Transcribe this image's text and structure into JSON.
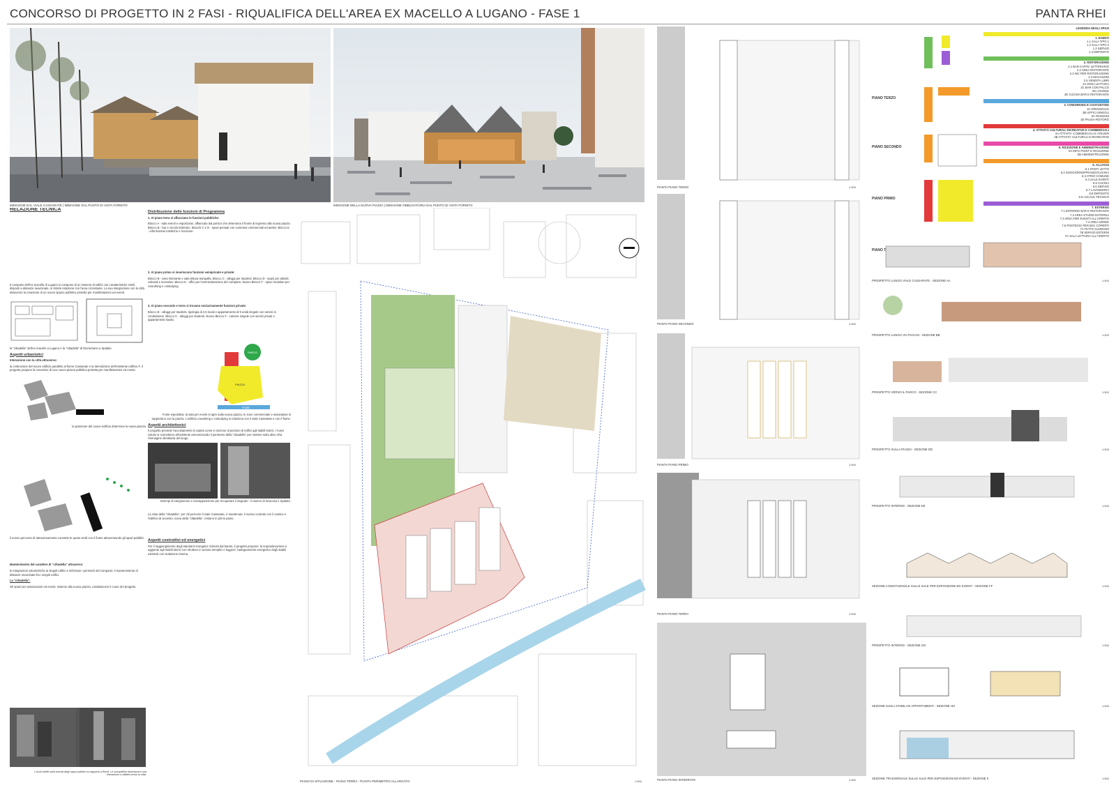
{
  "header": {
    "title": "CONCORSO DI PROGETTO IN 2 FASI - RIQUALIFICA DELL'AREA EX MACELLO A LUGANO - FASE 1",
    "team": "PANTA RHEI"
  },
  "renders": {
    "left_caption": "IMMAGINE DAL VIALE CASSARATE | IMMAGINE DAL PUNTO DI VISTA FORNITO",
    "right_caption": "IMMAGINE DELLA NUOVA PIAZZA | IMMAGINE OBBLIGATORIA DAL PUNTO DI VISTA FORNITO"
  },
  "report": {
    "title": "RELAZIONE TECNICA",
    "col1_intro": "Il comparto dell'ex macello di Lugano si compone di un insieme di edifici con caratteristiche simili, disposti a distanze ravvicinate, in stretta relazione con l'area circostante. La sua integrazione con la città attraverso la creazione di un nuovo spazio pubblico protetto per manifestazioni ed eventi.",
    "col1_fig_caption": "la \"cittadella\" dell'ex macello a Lugano e la \"cittadella\" di Diocleziano a Spalato",
    "urban_title": "Aspetti urbanistici",
    "urban_sub": "Interazione con la città attraverso:",
    "urban_text": "la costruzione del nuovo edificio parallelo al fiume Cassarate e la demolizione dell'esistente edificio F, il progetto propone la creazione di uno nuovo piazza pubblica protetta per manifestazioni ed eventi.",
    "diagram1_caption": "la posizione del nuovo edificio determina la nuova piazza",
    "diagram2_caption": "il nuovo percorso di attraversamento connette le quote verdi con il fiume attraversando gli spazi pubblici",
    "keep_title": "Mantenimento del carattere di \"cittadella\" attraverso:",
    "keep_text": "le integrazioni volumetriche ai singoli edifici a rinforzare i perimetri del comparto; il mantenimento di distanze ravvicinate fra i singoli edifici.",
    "lo_title": "La \"cittadella\":",
    "lo_text": "Gli spazi per associazioni ed eventi, insieme alla nuova piazza, costituiscono il cuore del progetto.",
    "photo_caption": "I vicoli stretti sulla moratt degli spazi pubblici si rapporta a Rivoli. Le prospettive favoriscono una interazione a attività verso la città."
  },
  "program": {
    "title": "Distribuzione delle funzioni di Programma",
    "s1_title": "1. Al piano terra si affacciano le funzioni pubbliche:",
    "s1_text": "Blocco A - sala eventi e esposizioni, affiancato dal portico che determina il fronte di ingresso alla nuova piazza. Blocco B - bar e circolo letterario. Blocchi C e D - spazi pensati con contenuti commerciali ed atelier. Blocco E - informazioni turistiche e ricezione.",
    "s2_title": "2. Al piano primo si inseriscono funzioni semiprivate e private:",
    "s2_text": "Blocco B - area ristorante e sala lettura tranquilla. Blocco C - alloggi per studenti. Blocco D - spazi per attività culturali e ricreative. Blocco E - uffici per l'amministrazione del comparto. Nuovo Blocco F - spazi modulari per coworking e costudying.",
    "s3_title": "3. Al piano secondo e terzo si trovano esclusivamente funzioni private:",
    "s3_text": "Blocco B - alloggi per studenti, tipologia di 2.5 locali e appartamento di 9 unità singole con servizi in condivisione. Blocco C - alloggi per studenti. Nuovo Blocco F - camere singole con servizi privati e appartamenti studio.",
    "diagram_labels": [
      "PARCO",
      "PIAZZA",
      "FIUME"
    ],
    "diagram_caption": "Fonte espositiva: la sala per eventi si apre sulla nuova piazza, le zone commerciale e associative si rapportano con la piazza. L'edificio coworking e costudying si relaziona con il viale Cassarate e con il fiume.",
    "arch_title": "Aspetti architettonici",
    "arch_text": "Il progetto prevede l'accostamento in pianta come in sezione di porzioni di edifici agli stabili storici. I nuovi volumi si connettono all'esistente armonizzando il perimetro della \"cittadella\" per mettere sotto altro cifra l'immagine identitaria del luogo.",
    "photo_caption": "Esempi di integrazione e sovrapposizione per recuperare il degrado - il duomo di Siracusa e Spalato.",
    "arch_text2": "La vista della \"cittadella\", per chi percorre il viale Cassarate, è mantenuta: il nucleo centrale con il camino e l'edificio di accesso, icona della \"cittadella\", restano in primo piano.",
    "energy_title": "Aspetti costruttivi ed energetici",
    "energy_text": "Per il raggiungimento degli standard energetici richiesti dal bando, il progetto propone: la sopraelevazione e aggiunte agli stabili storici con strutture in acciaio semplici e leggere; l'adeguamento energetico degli stabili esistenti con isolazione interna."
  },
  "site_plan": {
    "caption": "PIANO DI SITUAZIONE - PIANO TERRA - PIANTA PERIMETRO ALLARGATO",
    "scale": "1:500"
  },
  "plans": [
    {
      "caption": "PIANTA PIANO TERZO",
      "scale": "1:500"
    },
    {
      "caption": "PIANTA PIANO SECONDO",
      "scale": "1:500"
    },
    {
      "caption": "PIANTA PIANO PRIMO",
      "scale": "1:500"
    },
    {
      "caption": "PIANTA PIANO TERRA",
      "scale": "1:500"
    },
    {
      "caption": "PIANTA PIANO INTERRATO",
      "scale": "1:500"
    }
  ],
  "legend": {
    "title": "LEGENDA DEGLI SPAZI",
    "groups": [
      {
        "head": "1. EVENTI",
        "color": "#f1ea2a",
        "items": [
          "1.1 SALA TIPO 1",
          "1.2 SALA TIPO 2",
          "1.3 SERVIZI",
          "1.4 DEPOSITO"
        ]
      },
      {
        "head": "2. RISTORAZIONE",
        "color": "#6fc05a",
        "items": [
          "2.1 BAR CAFFE' LETTERARIO",
          "2.2 AREA RISTORANTE",
          "2.3 WC PER RISTORAZIONE",
          "2.4 MAGAZZINI",
          "2.5 VENDITA LIBRI",
          "2A ZONA LETTURA",
          "2C BAR CON PALCO",
          "2D LOUNGE",
          "2E CUCINA BAR E RISTORANTE"
        ]
      },
      {
        "head": "3. COWORKING E COSTUDYING",
        "color": "#5aa8dc",
        "items": [
          "3A OPENSPACE",
          "3B UFFICI SINGOLI",
          "3C RIUNIONI",
          "3D PAUSA-RISTORO"
        ]
      },
      {
        "head": "4. ATTIVITÀ CULTURALI RICREATIVE E COMMERCIALI",
        "color": "#e23a3a",
        "items": [
          "4A ATTIVITA' COMMERCIALI E ATELIER",
          "4B ATTIVITA' CULTURALI E RICREATIVE"
        ]
      },
      {
        "head": "5. RICEZIONE E AMMINISTRAZIONE",
        "color": "#e84aa8",
        "items": [
          "5A INFO POINT E RICEZIONE",
          "5B AMMINISTRAZIONE"
        ]
      },
      {
        "head": "6. ALLOGGI",
        "color": "#f39a2a",
        "items": [
          "6.1 POSTI LETTO",
          "6.2 SOGGIORNO/PRANZO/CUCINA",
          "6.3 ATRIO COMUNE",
          "6.4 SALE EVENTI",
          "6.5 CUCINA",
          "6.6 SERVIZI",
          "6.7 LAVANDERIA",
          "6.8 DEPOSITO",
          "6.9 LOCALE TECNICO"
        ]
      },
      {
        "head": "7. ESTERNO",
        "color": "#9b5ed6",
        "items": [
          "7.1 ESTERNO BAR E RISTORANTE",
          "7.2 AREA STUDIO ESTERNA",
          "7.3 AREA PER EVENTI ALL'APERTO",
          "7.4 AREA VERDE",
          "7.5 POSTEGGI PER BICI COPERTI",
          "7A TETTO GIARDINO",
          "7B SERVIZI ESTERNI",
          "7C SALA LETTURA ALL'APERTO"
        ]
      }
    ],
    "floors": [
      "PIANO TERZO",
      "PIANO SECONDO",
      "PIANO PRIMO",
      "PIANO TERRA"
    ]
  },
  "sections": [
    {
      "caption": "PROSPETTO LUNGO VIALE CASSARATE - SEZIONE AA",
      "scale": "1:500"
    },
    {
      "caption": "PROSPETTO LUNGO VIA PAGANI - SEZIONE BB",
      "scale": "1:500"
    },
    {
      "caption": "PROSPETTO VERSO IL PARCO - SEZIONE CC",
      "scale": "1:500"
    },
    {
      "caption": "PROSPETTO SULLA PIAZZA - SEZIONE DD",
      "scale": "1:500"
    },
    {
      "caption": "PROSPETTO INTERNO - SEZIONE EE",
      "scale": "1:500"
    },
    {
      "caption": "SEZIONE LONGITUDINALE SULLE SALE PER ESPOSIZIONI ED EVENTI - SEZIONE FF",
      "scale": "1:500"
    },
    {
      "caption": "PROSPETTO INTERNO - SEZIONE GG",
      "scale": "1:500"
    },
    {
      "caption": "SEZIONE SUGLI STABILI DI APPARTAMENTI - SEZIONE HH",
      "scale": "1:500"
    },
    {
      "caption": "SEZIONE TRASVERSALE SULLE SALE PER ESPOSIZIONI ED EVENTI - SEZIONE II",
      "scale": "1:500"
    }
  ]
}
